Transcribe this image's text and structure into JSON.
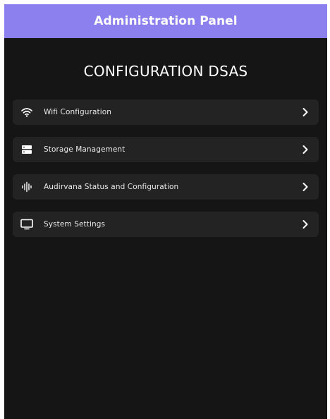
{
  "header": {
    "title": "Administration Panel"
  },
  "main": {
    "title": "CONFIGURATION DSAS",
    "menu": [
      {
        "label": "Wifi Configuration",
        "icon": "wifi-icon"
      },
      {
        "label": "Storage Management",
        "icon": "storage-icon"
      },
      {
        "label": "Audirvana Status and Configuration",
        "icon": "audio-waveform-icon"
      },
      {
        "label": "System Settings",
        "icon": "monitor-icon"
      }
    ]
  },
  "colors": {
    "header_bg": "#8b80ee",
    "app_bg": "#151515",
    "item_bg": "#232323",
    "text": "#ffffff"
  }
}
